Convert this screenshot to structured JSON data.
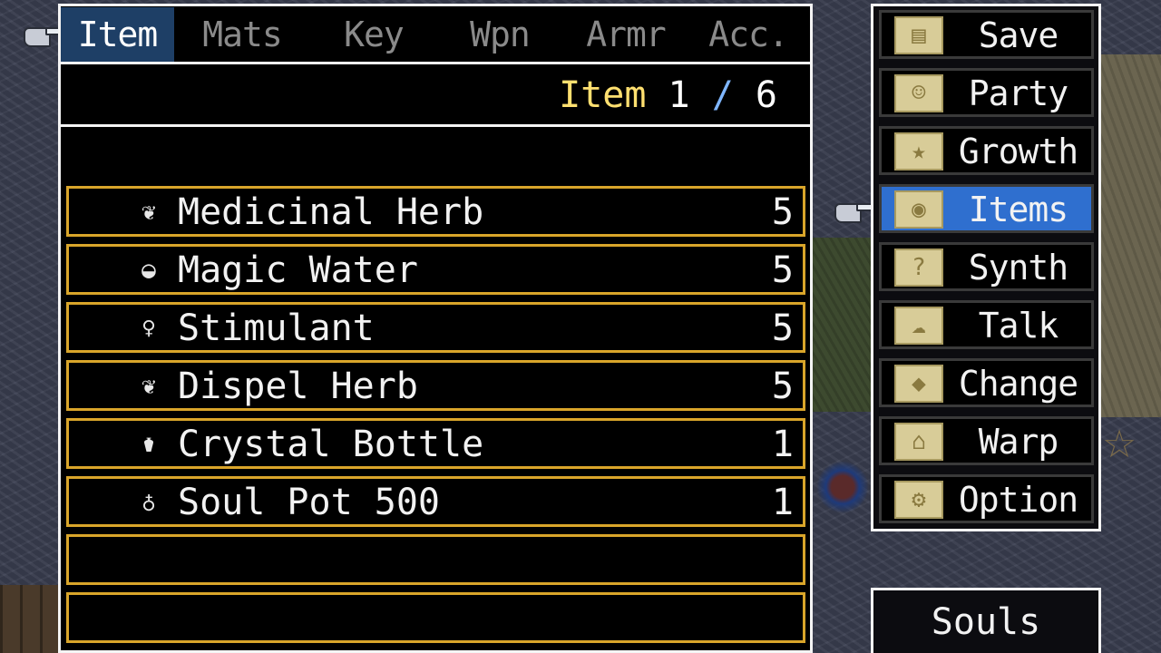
{
  "tabs": [
    {
      "label": "Item",
      "active": true
    },
    {
      "label": "Mats",
      "active": false
    },
    {
      "label": "Key",
      "active": false
    },
    {
      "label": "Wpn",
      "active": false
    },
    {
      "label": "Armr",
      "active": false
    },
    {
      "label": "Acc.",
      "active": false
    }
  ],
  "counter": {
    "label": "Item",
    "current": "1",
    "separator": "/",
    "total": "6"
  },
  "items": [
    {
      "name": "Medicinal Herb",
      "qty": "5",
      "icon": "herb-icon",
      "glyph": "❦"
    },
    {
      "name": "Magic Water",
      "qty": "5",
      "icon": "water-icon",
      "glyph": "◒"
    },
    {
      "name": "Stimulant",
      "qty": "5",
      "icon": "stimulant-icon",
      "glyph": "♀"
    },
    {
      "name": "Dispel Herb",
      "qty": "5",
      "icon": "herb-icon",
      "glyph": "❦"
    },
    {
      "name": "Crystal Bottle",
      "qty": "1",
      "icon": "bottle-icon",
      "glyph": "⚱"
    },
    {
      "name": "Soul Pot 500",
      "qty": "1",
      "icon": "potion-icon",
      "glyph": "♁"
    },
    {
      "name": "",
      "qty": "",
      "icon": "",
      "glyph": ""
    },
    {
      "name": "",
      "qty": "",
      "icon": "",
      "glyph": ""
    }
  ],
  "commands": [
    {
      "label": "Save",
      "icon": "save-icon",
      "glyph": "▤",
      "active": false
    },
    {
      "label": "Party",
      "icon": "party-icon",
      "glyph": "☺",
      "active": false
    },
    {
      "label": "Growth",
      "icon": "growth-icon",
      "glyph": "★",
      "active": false
    },
    {
      "label": "Items",
      "icon": "items-icon",
      "glyph": "◉",
      "active": true
    },
    {
      "label": "Synth",
      "icon": "synth-icon",
      "glyph": "?",
      "active": false
    },
    {
      "label": "Talk",
      "icon": "talk-icon",
      "glyph": "☁",
      "active": false
    },
    {
      "label": "Change",
      "icon": "change-icon",
      "glyph": "◆",
      "active": false
    },
    {
      "label": "Warp",
      "icon": "warp-icon",
      "glyph": "⌂",
      "active": false
    },
    {
      "label": "Option",
      "icon": "option-icon",
      "glyph": "⚙",
      "active": false
    }
  ],
  "souls": {
    "label": "Souls"
  },
  "colors": {
    "window_bg": "#000000",
    "border": "#f4f4f4",
    "item_border": "#d9a52a",
    "highlight": "#2f6fcf",
    "counter_label": "#ffe070"
  }
}
